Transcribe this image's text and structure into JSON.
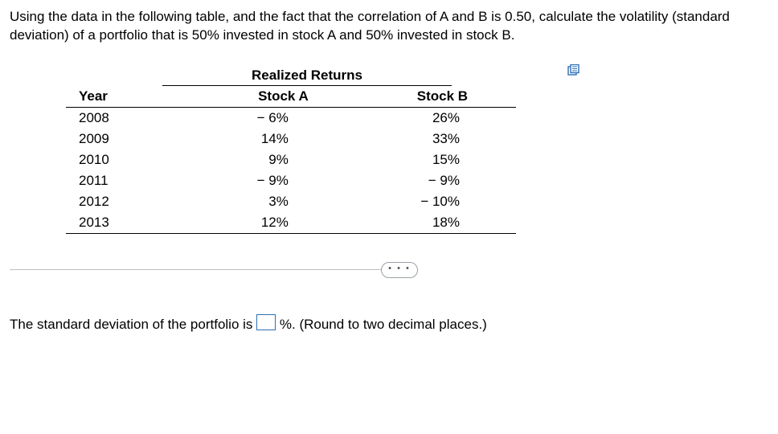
{
  "question": "Using the data in the following table, and the fact that the correlation of A and B is 0.50, calculate the volatility (standard deviation) of a portfolio that is 50% invested in stock A and 50% invested in stock B.",
  "table": {
    "section_title": "Realized Returns",
    "headers": {
      "year": "Year",
      "a": "Stock A",
      "b": "Stock B"
    },
    "rows": [
      {
        "year": "2008",
        "a": "− 6%",
        "b": "26%"
      },
      {
        "year": "2009",
        "a": "14%",
        "b": "33%"
      },
      {
        "year": "2010",
        "a": "9%",
        "b": "15%"
      },
      {
        "year": "2011",
        "a": "− 9%",
        "b": "− 9%"
      },
      {
        "year": "2012",
        "a": "3%",
        "b": "− 10%"
      },
      {
        "year": "2013",
        "a": "12%",
        "b": "18%"
      }
    ]
  },
  "ellipsis": "• • •",
  "answer": {
    "prefix": "The standard deviation of the portfolio is ",
    "suffix": "%.  ",
    "hint": "(Round to two decimal places.)"
  },
  "chart_data": {
    "type": "table",
    "title": "Realized Returns",
    "columns": [
      "Year",
      "Stock A",
      "Stock B"
    ],
    "rows": [
      [
        "2008",
        -6,
        26
      ],
      [
        "2009",
        14,
        33
      ],
      [
        "2010",
        9,
        15
      ],
      [
        "2011",
        -9,
        -9
      ],
      [
        "2012",
        3,
        -10
      ],
      [
        "2013",
        12,
        18
      ]
    ],
    "units": "percent",
    "given": {
      "correlation_AB": 0.5,
      "weight_A": 0.5,
      "weight_B": 0.5
    }
  }
}
